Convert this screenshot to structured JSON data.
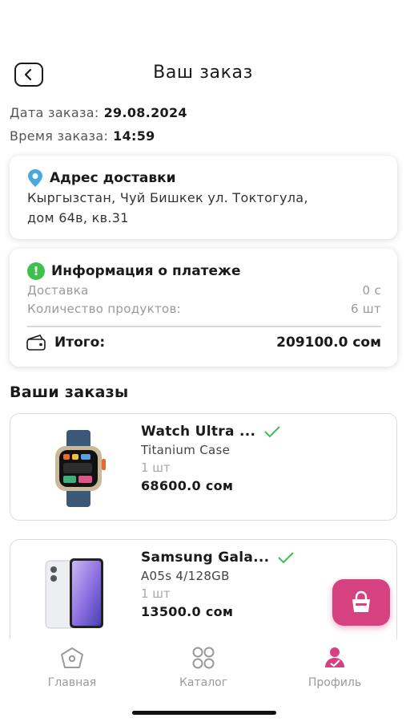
{
  "header": {
    "title": "Ваш заказ"
  },
  "order_meta": {
    "date_label": "Дата заказа:",
    "date_value": "29.08.2024",
    "time_label": "Время заказа:",
    "time_value": "14:59"
  },
  "address": {
    "title": "Адрес доставки",
    "line1": "Кыргызстан, Чуй Бишкек ул. Токтогула,",
    "line2": "дом 64в, кв.31"
  },
  "payment": {
    "title": "Информация о платеже",
    "delivery_label": "Доставка",
    "delivery_value": "0 с",
    "qty_label": "Количество продуктов:",
    "qty_value": "6 шт",
    "total_label": "Итого:",
    "total_value": "209100.0 сом"
  },
  "orders": {
    "section_title": "Ваши заказы",
    "items": [
      {
        "name": "Watch Ultra ...",
        "variant": "Titanium Case",
        "qty": "1 шт",
        "price": "68600.0 сом"
      },
      {
        "name": "Samsung Gala...",
        "variant": "A05s 4/128GB",
        "qty": "1 шт",
        "price": "13500.0 сом"
      }
    ]
  },
  "tabs": [
    {
      "label": "Главная",
      "icon": "home-icon"
    },
    {
      "label": "Каталог",
      "icon": "catalog-icon"
    },
    {
      "label": "Профиль",
      "icon": "profile-icon"
    }
  ],
  "colors": {
    "accent": "#d6417f",
    "check": "#3ec04c",
    "pin": "#4aa8e0"
  }
}
